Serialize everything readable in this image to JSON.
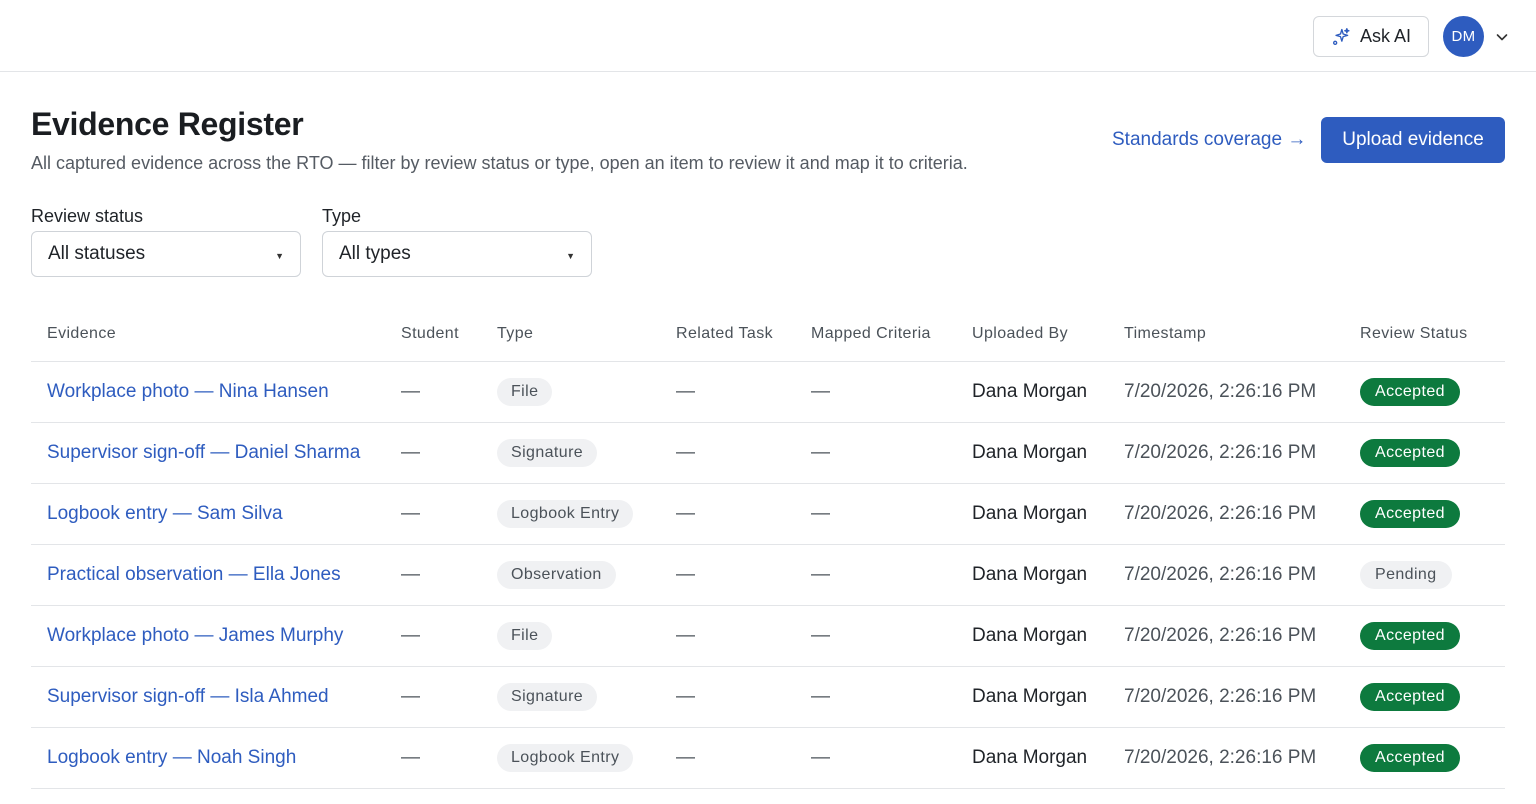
{
  "topbar": {
    "ask_ai_label": "Ask AI",
    "user_initials": "DM",
    "avatar_color": "#2e5cbf"
  },
  "page": {
    "title": "Evidence Register",
    "subtitle": "All captured evidence across the RTO — filter by review status or type, open an item to review it and map it to criteria.",
    "coverage_link": "Standards coverage →",
    "upload_button": "Upload evidence"
  },
  "filters": {
    "status_label": "Review status",
    "status_value": "All statuses",
    "type_label": "Type",
    "type_value": "All types"
  },
  "table": {
    "columns": [
      "Evidence",
      "Student",
      "Type",
      "Related Task",
      "Mapped Criteria",
      "Uploaded By",
      "Timestamp",
      "Review Status"
    ],
    "rows": [
      {
        "evidence": "Workplace photo — Nina Hansen",
        "student": "—",
        "type": "File",
        "task": "—",
        "criteria": "—",
        "uploaded_by": "Dana Morgan",
        "timestamp": "7/20/2026, 2:26:16 PM",
        "status": "Accepted"
      },
      {
        "evidence": "Supervisor sign-off — Daniel Sharma",
        "student": "—",
        "type": "Signature",
        "task": "—",
        "criteria": "—",
        "uploaded_by": "Dana Morgan",
        "timestamp": "7/20/2026, 2:26:16 PM",
        "status": "Accepted"
      },
      {
        "evidence": "Logbook entry — Sam Silva",
        "student": "—",
        "type": "Logbook Entry",
        "task": "—",
        "criteria": "—",
        "uploaded_by": "Dana Morgan",
        "timestamp": "7/20/2026, 2:26:16 PM",
        "status": "Accepted"
      },
      {
        "evidence": "Practical observation — Ella Jones",
        "student": "—",
        "type": "Observation",
        "task": "—",
        "criteria": "—",
        "uploaded_by": "Dana Morgan",
        "timestamp": "7/20/2026, 2:26:16 PM",
        "status": "Pending"
      },
      {
        "evidence": "Workplace photo — James Murphy",
        "student": "—",
        "type": "File",
        "task": "—",
        "criteria": "—",
        "uploaded_by": "Dana Morgan",
        "timestamp": "7/20/2026, 2:26:16 PM",
        "status": "Accepted"
      },
      {
        "evidence": "Supervisor sign-off — Isla Ahmed",
        "student": "—",
        "type": "Signature",
        "task": "—",
        "criteria": "—",
        "uploaded_by": "Dana Morgan",
        "timestamp": "7/20/2026, 2:26:16 PM",
        "status": "Accepted"
      },
      {
        "evidence": "Logbook entry — Noah Singh",
        "student": "—",
        "type": "Logbook Entry",
        "task": "—",
        "criteria": "—",
        "uploaded_by": "Dana Morgan",
        "timestamp": "7/20/2026, 2:26:16 PM",
        "status": "Accepted"
      }
    ]
  },
  "colors": {
    "accent": "#2e5cbf",
    "accepted": "#0d7a3e",
    "pending_bg": "#f0f1f3"
  },
  "icons": {
    "ask_ai": "sparkle-icon",
    "user_menu": "chevron-down-icon",
    "select_caret": "caret-down-icon"
  }
}
